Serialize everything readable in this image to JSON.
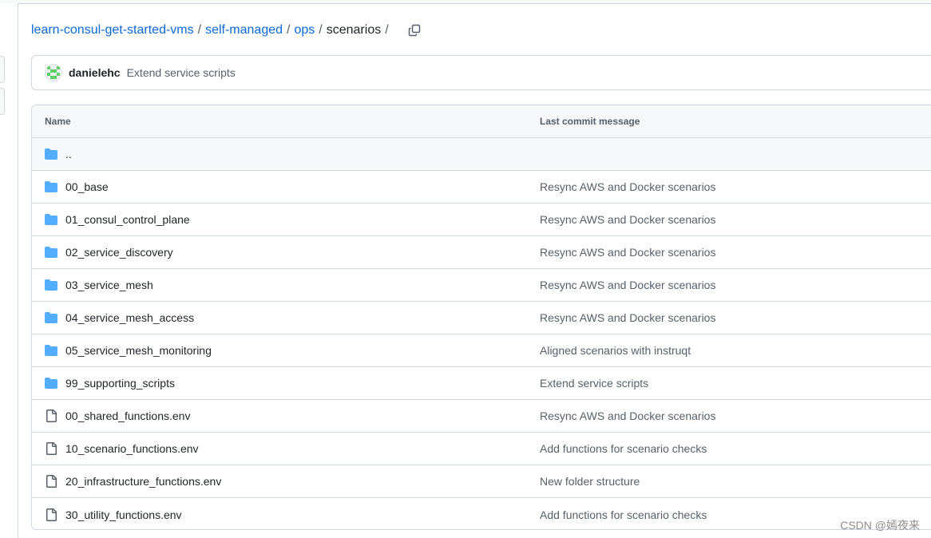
{
  "breadcrumb": {
    "items": [
      {
        "label": "learn-consul-get-started-vms",
        "link": true
      },
      {
        "label": "self-managed",
        "link": true
      },
      {
        "label": "ops",
        "link": true
      },
      {
        "label": "scenarios",
        "link": false
      }
    ],
    "separator": "/",
    "copy_icon": "copy-icon"
  },
  "latest_commit": {
    "avatar_icon": "avatar-identicon",
    "author": "danielehc",
    "message": "Extend service scripts"
  },
  "table": {
    "columns": {
      "name": "Name",
      "message": "Last commit message"
    },
    "parent_row": {
      "name": "..",
      "icon": "folder-icon"
    },
    "rows": [
      {
        "type": "folder",
        "icon": "folder-icon",
        "name": "00_base",
        "message": "Resync AWS and Docker scenarios"
      },
      {
        "type": "folder",
        "icon": "folder-icon",
        "name": "01_consul_control_plane",
        "message": "Resync AWS and Docker scenarios"
      },
      {
        "type": "folder",
        "icon": "folder-icon",
        "name": "02_service_discovery",
        "message": "Resync AWS and Docker scenarios"
      },
      {
        "type": "folder",
        "icon": "folder-icon",
        "name": "03_service_mesh",
        "message": "Resync AWS and Docker scenarios"
      },
      {
        "type": "folder",
        "icon": "folder-icon",
        "name": "04_service_mesh_access",
        "message": "Resync AWS and Docker scenarios"
      },
      {
        "type": "folder",
        "icon": "folder-icon",
        "name": "05_service_mesh_monitoring",
        "message": "Aligned scenarios with instruqt"
      },
      {
        "type": "folder",
        "icon": "folder-icon",
        "name": "99_supporting_scripts",
        "message": "Extend service scripts"
      },
      {
        "type": "file",
        "icon": "file-icon",
        "name": "00_shared_functions.env",
        "message": "Resync AWS and Docker scenarios"
      },
      {
        "type": "file",
        "icon": "file-icon",
        "name": "10_scenario_functions.env",
        "message": "Add functions for scenario checks"
      },
      {
        "type": "file",
        "icon": "file-icon",
        "name": "20_infrastructure_functions.env",
        "message": "New folder structure"
      },
      {
        "type": "file",
        "icon": "file-icon",
        "name": "30_utility_functions.env",
        "message": "Add functions for scenario checks"
      }
    ]
  },
  "watermark": "CSDN @嫣夜来",
  "colors": {
    "link": "#0969da",
    "folder": "#54aeff",
    "muted": "#57606a",
    "border": "#d0d7de",
    "header_bg": "#f6f8fa",
    "avatar": "#5fd068"
  }
}
